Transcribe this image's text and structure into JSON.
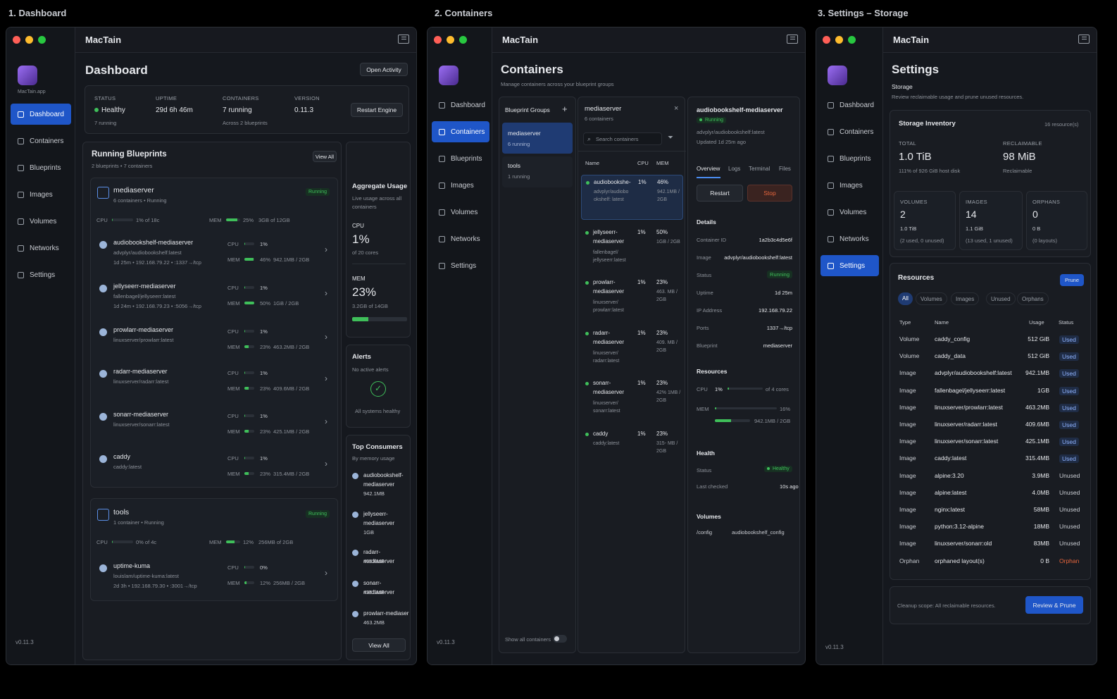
{
  "sections": {
    "s1": "1. Dashboard",
    "s2": "2. Containers",
    "s3": "3. Settings – Storage"
  },
  "app": {
    "name": "MacTain",
    "sub": "MacTain.app",
    "version": "v0.11.3"
  },
  "nav": [
    "Dashboard",
    "Containers",
    "Blueprints",
    "Images",
    "Volumes",
    "Networks",
    "Settings"
  ],
  "colors": {
    "accent": "#1f56c8",
    "green": "#3fbf5a",
    "orange": "#e8663d",
    "bg": "#15181e"
  },
  "dashboard": {
    "title": "Dashboard",
    "open_activity": "Open Activity",
    "status": {
      "label": "STATUS",
      "value": "Healthy",
      "sub": "7 running"
    },
    "uptime": {
      "label": "UPTIME",
      "value": "29d 6h 46m"
    },
    "containers": {
      "label": "CONTAINERS",
      "value": "7 running",
      "sub": "Across 2 blueprints"
    },
    "version": {
      "label": "VERSION",
      "value": "0.11.3"
    },
    "restart_engine": "Restart Engine",
    "running_title": "Running Blueprints",
    "running_sub": "2 blueprints • 7 containers",
    "view_all": "View All",
    "cpu_label": "CPU",
    "mem_label": "MEM",
    "bp1": {
      "name": "mediaserver",
      "sub": "6 containers • Running",
      "badge": "Running",
      "cpu": "1% of 18c",
      "mem_pct": "25%",
      "mem": "3GB of 12GB"
    },
    "c": [
      {
        "name": "audiobookshelf-mediaserver",
        "image": "advplyr/audiobookshelf:latest",
        "meta": "1d 25m • 192.168.79.22 • :1337→/tcp",
        "cpu": "1%",
        "mem": "46%",
        "memv": "942.1MB / 2GB",
        "mp": 0.46
      },
      {
        "name": "jellyseerr-mediaserver",
        "image": "fallenbagel/jellyseerr:latest",
        "meta": "1d 24m • 192.168.79.23 • :5056→/tcp",
        "cpu": "1%",
        "mem": "50%",
        "memv": "1GB / 2GB",
        "mp": 0.5
      },
      {
        "name": "prowlarr-mediaserver",
        "image": "linuxserver/prowlarr:latest",
        "meta": "",
        "cpu": "1%",
        "mem": "23%",
        "memv": "463.2MB / 2GB",
        "mp": 0.23
      },
      {
        "name": "radarr-mediaserver",
        "image": "linuxserver/radarr:latest",
        "meta": "",
        "cpu": "1%",
        "mem": "23%",
        "memv": "409.6MB / 2GB",
        "mp": 0.23
      },
      {
        "name": "sonarr-mediaserver",
        "image": "linuxserver/sonarr:latest",
        "meta": "",
        "cpu": "1%",
        "mem": "23%",
        "memv": "425.1MB / 2GB",
        "mp": 0.23
      },
      {
        "name": "caddy",
        "image": "caddy:latest",
        "meta": "",
        "cpu": "1%",
        "mem": "23%",
        "memv": "315.4MB / 2GB",
        "mp": 0.23
      }
    ],
    "bp2": {
      "name": "tools",
      "sub": "1 container • Running",
      "badge": "Running",
      "cpu": "0% of 4c",
      "mem_pct": "12%",
      "mem": "256MB of 2GB"
    },
    "c7": {
      "name": "uptime-kuma",
      "image": "louislam/uptime-kuma:latest",
      "meta": "2d 3h • 192.168.79.30 • :3001→/tcp",
      "cpu": "0%",
      "mem": "12%",
      "memv": "256MB / 2GB",
      "mp": 0.12
    },
    "agg": {
      "title": "Aggregate Usage",
      "sub": "Live usage across all containers",
      "cpu_label": "CPU",
      "cpu": "1%",
      "cpu_sub": "of 20 cores",
      "mem_label": "MEM",
      "mem": "23%",
      "mem_sub": "3.2GB of 14GB",
      "mem_frac": 0.3
    },
    "alerts": {
      "title": "Alerts",
      "sub": "No active alerts",
      "ok": "All systems healthy"
    },
    "top": {
      "title": "Top Consumers",
      "sub": "By memory usage",
      "items": [
        {
          "name": "audiobookshelf-mediaserver",
          "v": "942.1MB"
        },
        {
          "name": "jellyseerr-mediaserver",
          "v": "1GB"
        },
        {
          "name": "radarr-mediaserver",
          "v": "409.6MB"
        },
        {
          "name": "sonarr-mediaserver",
          "v": "425.1MB"
        },
        {
          "name": "prowlarr-mediaser",
          "v": "463.2MB"
        }
      ],
      "view_all": "View All"
    }
  },
  "containers": {
    "title": "Containers",
    "sub": "Manage containers across your blueprint groups",
    "groups_title": "Blueprint Groups",
    "groups": [
      {
        "name": "mediaserver",
        "sub": "6 running"
      },
      {
        "name": "tools",
        "sub": "1 running"
      }
    ],
    "show_all": "Show all containers",
    "list_title": "mediaserver",
    "list_sub": "6 containers",
    "search_ph": "Search containers",
    "cols": {
      "name": "Name",
      "cpu": "CPU",
      "mem": "MEM"
    },
    "rows": [
      {
        "n1": "audiobookshe-",
        "n2": "",
        "img": "advplyr/audiobo okshelf: latest",
        "cpu": "1%",
        "mem": "46%",
        "mv": "942.1MB / 2GB"
      },
      {
        "n1": "jellyseerr-",
        "n2": "mediaserver",
        "img": "fallenbagel/ jellyseerr:latest",
        "cpu": "1%",
        "mem": "50%",
        "mv": "1GB / 2GB"
      },
      {
        "n1": "prowlarr-",
        "n2": "mediaserver",
        "img": "linuxserver/ prowlarr:latest",
        "cpu": "1%",
        "mem": "23%",
        "mv": "463. MB / 2GB"
      },
      {
        "n1": "radarr-",
        "n2": "mediaserver",
        "img": "linuxserver/ radarr:latest",
        "cpu": "1%",
        "mem": "23%",
        "mv": "409. MB / 2GB"
      },
      {
        "n1": "sonarr-",
        "n2": "mediaserver",
        "img": "linuxserver/ sonarr:latest",
        "cpu": "1%",
        "mem": "23%",
        "mv": "42% 1MB / 2GB"
      },
      {
        "n1": "caddy",
        "n2": "",
        "img": "caddy:latest",
        "cpu": "1%",
        "mem": "23%",
        "mv": "315- MB / 2GB"
      }
    ],
    "detail": {
      "title": "audiobookshelf-mediaserver",
      "status": "Running",
      "image": "advplyr/audiobookshelf:latest",
      "updated": "Updated 1d 25m ago",
      "tabs": [
        "Overview",
        "Logs",
        "Terminal",
        "Files"
      ],
      "restart": "Restart",
      "stop": "Stop",
      "details_title": "Details",
      "kv": [
        {
          "k": "Container ID",
          "v": "1a2b3c4d5e6f"
        },
        {
          "k": "Image",
          "v": "advplyr/audiobookshelf:latest"
        },
        {
          "k": "Status",
          "v": "Running"
        },
        {
          "k": "Uptime",
          "v": "1d 25m"
        },
        {
          "k": "IP Address",
          "v": "192.168.79.22"
        },
        {
          "k": "Ports",
          "v": "1337→/tcp"
        },
        {
          "k": "Blueprint",
          "v": "mediaserver"
        }
      ],
      "res_title": "Resources",
      "cpu_label": "CPU",
      "cpu": "1%",
      "cpu_of": "of 4 cores",
      "mem_label": "MEM",
      "mem_pct": "16%",
      "mem_v": "942.1MB / 2GB",
      "health_title": "Health",
      "health_status_k": "Status",
      "health_status_v": "Healthy",
      "last_k": "Last checked",
      "last_v": "10s ago",
      "vol_title": "Volumes",
      "vol_k": "/config",
      "vol_v": "audiobookshelf_config"
    }
  },
  "settings": {
    "title": "Settings",
    "sub": "Storage",
    "desc": "Review reclaimable usage and prune unused resources.",
    "inv_title": "Storage Inventory",
    "inv_count": "16 resource(s)",
    "total": {
      "label": "TOTAL",
      "value": "1.0 TiB",
      "sub": "111% of 926 GiB host disk"
    },
    "reclaim": {
      "label": "RECLAIMABLE",
      "value": "98 MiB",
      "sub": "Reclaimable"
    },
    "vol": {
      "label": "VOLUMES",
      "value": "2",
      "size": "1.0 TiB",
      "sub": "(2 used, 0 unused)"
    },
    "img": {
      "label": "IMAGES",
      "value": "14",
      "size": "1.1 GiB",
      "sub": "(13 used, 1 unused)"
    },
    "orph": {
      "label": "ORPHANS",
      "value": "0",
      "size": "0 B",
      "sub": "(0 layouts)"
    },
    "res_title": "Resources",
    "prune": "Prune",
    "filters": [
      "All",
      "Volumes",
      "Images",
      "Unused",
      "Orphans"
    ],
    "cols": {
      "type": "Type",
      "name": "Name",
      "usage": "Usage",
      "status": "Status"
    },
    "rows": [
      {
        "t": "Volume",
        "n": "caddy_config",
        "u": "512 GiB",
        "s": "Used"
      },
      {
        "t": "Volume",
        "n": "caddy_data",
        "u": "512 GiB",
        "s": "Used"
      },
      {
        "t": "Image",
        "n": "advplyr/audiobookshelf:latest",
        "u": "942.1MB",
        "s": "Used"
      },
      {
        "t": "Image",
        "n": "fallenbagel/jellyseerr:latest",
        "u": "1GB",
        "s": "Used"
      },
      {
        "t": "Image",
        "n": "linuxserver/prowlarr:latest",
        "u": "463.2MB",
        "s": "Used"
      },
      {
        "t": "Image",
        "n": "linuxserver/radarr:latest",
        "u": "409.6MB",
        "s": "Used"
      },
      {
        "t": "Image",
        "n": "linuxserver/sonarr:latest",
        "u": "425.1MB",
        "s": "Used"
      },
      {
        "t": "Image",
        "n": "caddy:latest",
        "u": "315.4MB",
        "s": "Used"
      },
      {
        "t": "Image",
        "n": "alpine:3.20",
        "u": "3.9MB",
        "s": "Unused"
      },
      {
        "t": "Image",
        "n": "alpine:latest",
        "u": "4.0MB",
        "s": "Unused"
      },
      {
        "t": "Image",
        "n": "nginx:latest",
        "u": "58MB",
        "s": "Unused"
      },
      {
        "t": "Image",
        "n": "python:3.12-alpine",
        "u": "18MB",
        "s": "Unused"
      },
      {
        "t": "Image",
        "n": "linuxserver/sonarr:old",
        "u": "83MB",
        "s": "Unused"
      },
      {
        "t": "Orphan",
        "n": "orphaned layout(s)",
        "u": "0 B",
        "s": "Orphan"
      }
    ],
    "scope": "Cleanup scope: All reclaimable resources.",
    "review": "Review & Prune"
  }
}
